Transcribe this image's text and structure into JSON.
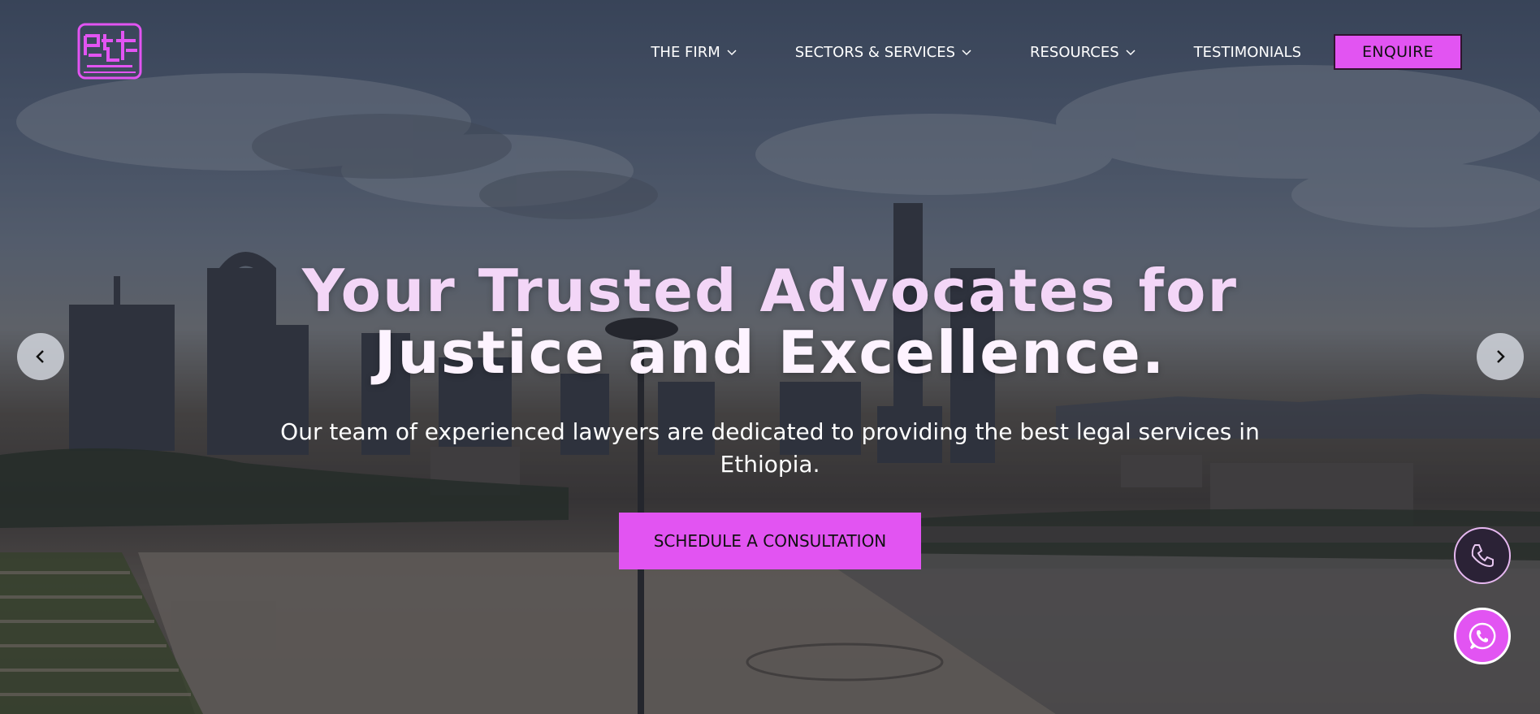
{
  "brand": {
    "logo_icon": "firm-logo-icon",
    "accent_color": "#e254f2"
  },
  "nav": {
    "items": [
      {
        "label": "THE FIRM",
        "dropdown": true
      },
      {
        "label": "SECTORS & SERVICES",
        "dropdown": true
      },
      {
        "label": "RESOURCES",
        "dropdown": true
      },
      {
        "label": "TESTIMONIALS",
        "dropdown": false
      }
    ],
    "enquire_label": "ENQUIRE"
  },
  "hero": {
    "headline_line1": "Your Trusted Advocates for",
    "headline_line2": "Justice and Excellence.",
    "subheadline": "Our team of experienced lawyers are dedicated to providing the best legal services in Ethiopia.",
    "cta_label": "SCHEDULE A CONSULTATION"
  },
  "slider": {
    "prev_icon": "chevron-left-icon",
    "next_icon": "chevron-right-icon"
  },
  "contact": {
    "phone_icon": "phone-icon",
    "whatsapp_icon": "whatsapp-icon"
  }
}
